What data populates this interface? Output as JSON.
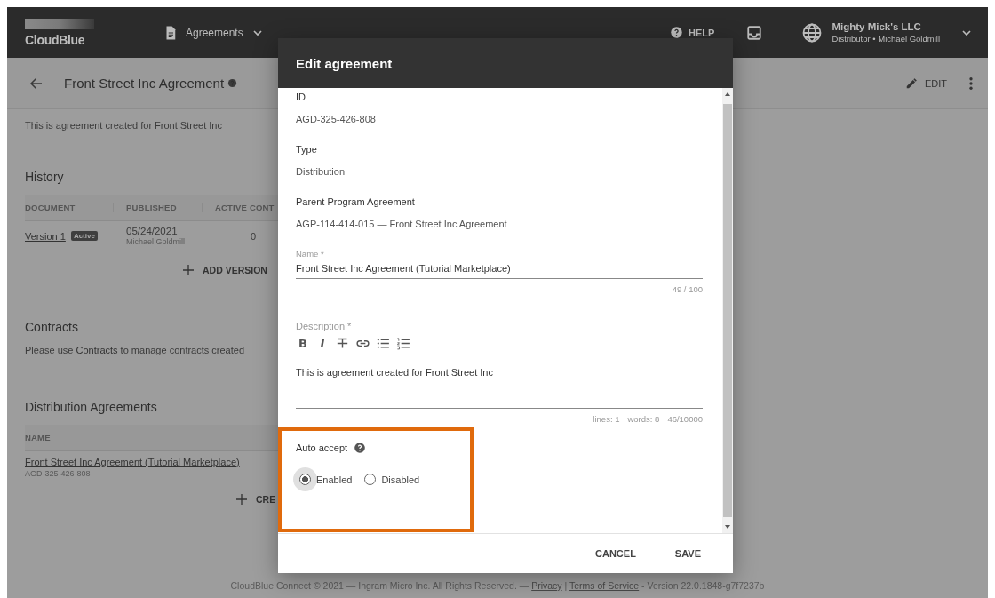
{
  "header": {
    "logo": "CloudBlue",
    "nav": "Agreements",
    "help": "HELP",
    "account": {
      "name": "Mighty Mick's LLC",
      "subtitle": "Distributor • Michael Goldmill"
    }
  },
  "subheader": {
    "title": "Front Street Inc Agreement",
    "edit": "EDIT"
  },
  "description": "This is agreement created for Front Street Inc",
  "history": {
    "title": "History",
    "columns": [
      "DOCUMENT",
      "PUBLISHED",
      "ACTIVE CONT"
    ],
    "rows": [
      {
        "document": "Version 1",
        "badge": "Active",
        "date": "05/24/2021",
        "author": "Michael Goldmill",
        "active_contracts": "0"
      }
    ],
    "add_button": "ADD VERSION"
  },
  "contracts": {
    "title": "Contracts",
    "before": "Please use ",
    "link": "Contracts",
    "after": " to manage contracts created"
  },
  "distribution": {
    "title": "Distribution Agreements",
    "columns": [
      "NAME"
    ],
    "rows": [
      {
        "name": "Front Street Inc Agreement (Tutorial Marketplace)",
        "id": "AGD-325-426-808"
      }
    ],
    "create_button": "CRE"
  },
  "footer": {
    "before": "CloudBlue Connect © 2021 — Ingram Micro Inc. All Rights Reserved. — ",
    "privacy": "Privacy",
    "separator": " | ",
    "terms": "Terms of Service",
    "after": " - Version 22.0.1848-g7f7237b"
  },
  "modal": {
    "title": "Edit agreement",
    "fields": [
      {
        "kind": "readonly",
        "label": "ID",
        "value": "AGD-325-426-808"
      },
      {
        "kind": "readonly",
        "label": "Type",
        "value": "Distribution"
      },
      {
        "kind": "readonly",
        "label": "Parent Program Agreement",
        "value": "AGP-114-414-015 — Front Street Inc Agreement"
      },
      {
        "kind": "text",
        "label": "Name *",
        "value": "Front Street Inc Agreement (Tutorial Marketplace)",
        "counter": "49 / 100"
      },
      {
        "kind": "richtext",
        "label": "Description *",
        "toolbar": [
          {
            "kind": "char",
            "label": "B"
          },
          {
            "kind": "char",
            "label": "I"
          },
          {
            "kind": "strike"
          },
          {
            "kind": "link"
          },
          {
            "kind": "bullets"
          },
          {
            "kind": "numbers"
          }
        ],
        "value": "This is agreement created for Front Street Inc",
        "stats": [
          "lines: 1",
          "words: 8",
          "46/10000"
        ]
      }
    ],
    "auto_accept": {
      "label": "Auto accept",
      "options": [
        {
          "label": "Enabled",
          "selected": true
        },
        {
          "label": "Disabled",
          "selected": false
        }
      ]
    },
    "buttons": [
      "CANCEL",
      "SAVE"
    ]
  }
}
